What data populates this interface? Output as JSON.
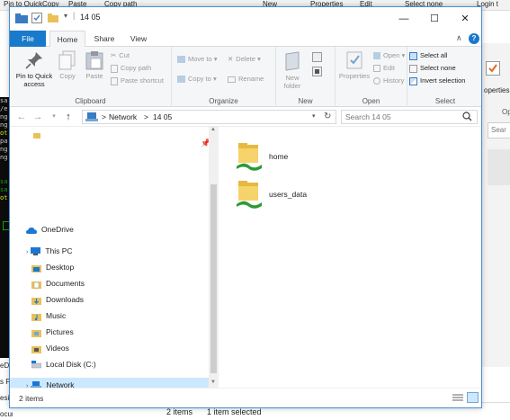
{
  "background": {
    "top_labels": [
      "Pin to Quick",
      "Copy",
      "Paste",
      "Copy path",
      "New",
      "Properties",
      "Edit",
      "Select none",
      "Login t"
    ],
    "terminal_lines": [
      "sa",
      "/e",
      "ng",
      "ng",
      "ot",
      "pa",
      "ng",
      "ng",
      "",
      "",
      "sa",
      "sa",
      "ot",
      ""
    ],
    "left_texts": [
      "eD",
      "s P",
      "esi",
      "ocuments"
    ],
    "right_texts": [
      "operties",
      "Op",
      "Sear"
    ],
    "bottom_items": "2 items",
    "bottom_selected": "1 item selected"
  },
  "titlebar": {
    "path_text": "14           05",
    "minimize": "—",
    "maximize": "☐",
    "close": "✕"
  },
  "tabs": {
    "file": "File",
    "home": "Home",
    "share": "Share",
    "view": "View"
  },
  "ribbon": {
    "clipboard": {
      "label": "Clipboard",
      "pin": "Pin to Quick",
      "pin2": "access",
      "copy": "Copy",
      "paste": "Paste",
      "cut": "Cut",
      "copy_path": "Copy path",
      "paste_shortcut": "Paste shortcut"
    },
    "organize": {
      "label": "Organize",
      "move_to": "Move to",
      "copy_to": "Copy to",
      "delete": "Delete",
      "rename": "Rename"
    },
    "new": {
      "label": "New",
      "new_folder": "New",
      "new_folder2": "folder"
    },
    "open": {
      "label": "Open",
      "properties": "Properties",
      "open": "Open",
      "edit": "Edit",
      "history": "History"
    },
    "select": {
      "label": "Select",
      "select_all": "Select all",
      "select_none": "Select none",
      "invert": "Invert selection"
    }
  },
  "address": {
    "crumb_sep": ">",
    "network": "Network",
    "host": "14           05",
    "search_placeholder": "Search 14           05"
  },
  "nav": {
    "onedrive": "OneDrive",
    "this_pc": "This PC",
    "desktop": "Desktop",
    "documents": "Documents",
    "downloads": "Downloads",
    "music": "Music",
    "pictures": "Pictures",
    "videos": "Videos",
    "local_disk": "Local Disk (C:)",
    "network": "Network"
  },
  "content": {
    "items": [
      "home",
      "users_data"
    ]
  },
  "status": {
    "count": "2 items"
  }
}
